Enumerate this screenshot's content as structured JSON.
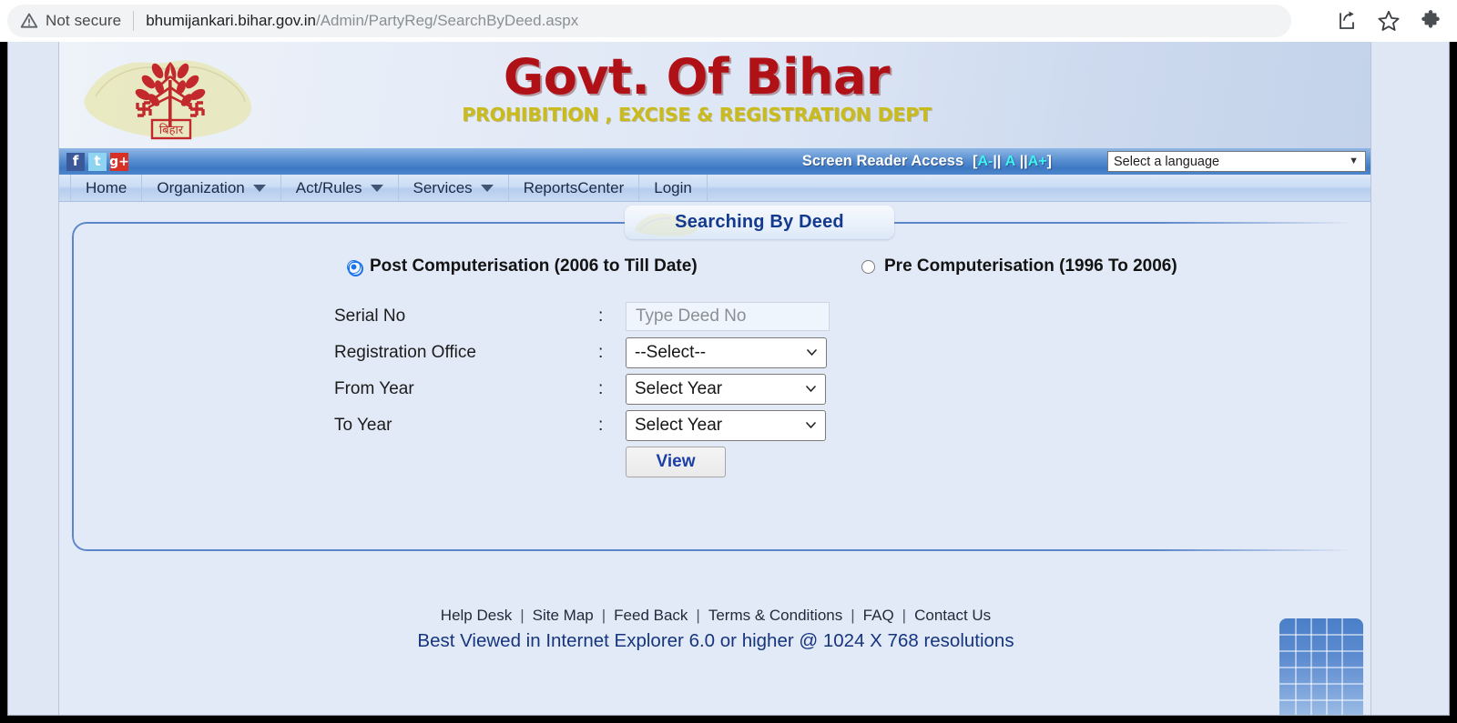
{
  "browser": {
    "security_label": "Not secure",
    "url_host": "bhumijankari.bihar.gov.in",
    "url_path": "/Admin/PartyReg/SearchByDeed.aspx",
    "icons": [
      "warning-triangle-icon",
      "share-icon",
      "bookmark-star-icon",
      "extensions-puzzle-icon"
    ]
  },
  "header": {
    "gov_title": "Govt. Of Bihar",
    "dept_title": "PROHIBITION , EXCISE & REGISTRATION DEPT",
    "emblem_alt": "bihar-state-emblem"
  },
  "social_bar": {
    "facebook_label": "f",
    "twitter_label": "t",
    "googleplus_label": "g+",
    "screen_reader_label": "Screen Reader Access",
    "size_decrease": "A-",
    "size_normal": "A",
    "size_increase": "A+",
    "language_selected": "Select a language"
  },
  "nav": {
    "items": [
      {
        "label": "Home",
        "has_caret": false
      },
      {
        "label": "Organization",
        "has_caret": true
      },
      {
        "label": "Act/Rules",
        "has_caret": true
      },
      {
        "label": "Services",
        "has_caret": true
      },
      {
        "label": "ReportsCenter",
        "has_caret": false
      },
      {
        "label": "Login",
        "has_caret": false
      }
    ]
  },
  "panel": {
    "title": "Searching By Deed"
  },
  "form": {
    "radio_post": "Post Computerisation (2006 to Till Date)",
    "radio_pre": "Pre Computerisation (1996 To 2006)",
    "radio_post_selected": true,
    "radio_pre_selected": false,
    "colon": ":",
    "label_serial_no": "Serial No",
    "label_registration_office": "Registration Office",
    "label_from_year": "From Year",
    "label_to_year": "To Year",
    "serial_no_value": "",
    "serial_no_placeholder": "Type Deed No",
    "registration_office_value": "--Select--",
    "from_year_value": "Select Year",
    "to_year_value": "Select Year",
    "view_button": "View"
  },
  "footer": {
    "links": [
      "Help Desk",
      "Site Map",
      "Feed Back",
      "Terms & Conditions",
      "FAQ",
      "Contact Us"
    ],
    "separator": "|",
    "best_viewed": "Best Viewed in Internet Explorer 6.0 or higher @ 1024 X 768 resolutions"
  },
  "colors": {
    "brand_red": "#b01116",
    "brand_yellow": "#c9bb1c",
    "nav_blue": "#3d79c4",
    "panel_border": "#5b86c9",
    "accent_text": "#16357f",
    "page_bg": "#e3eaf7"
  }
}
